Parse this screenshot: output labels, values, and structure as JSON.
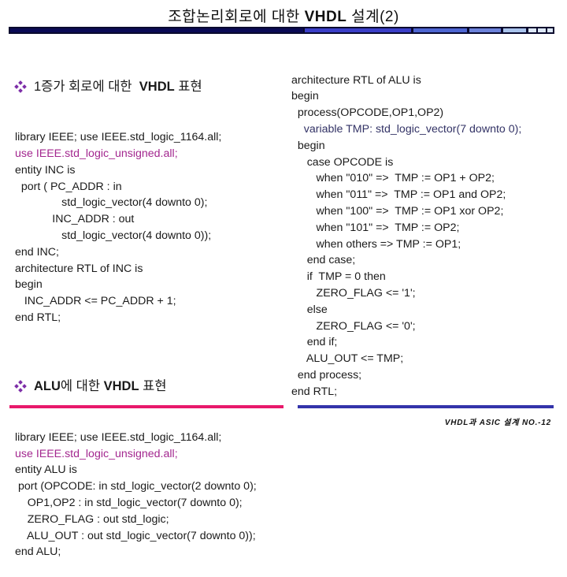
{
  "header": {
    "title_prefix": "조합논리회로에 대한 ",
    "title_bold": "VHDL",
    "title_suffix": " 설계(2)",
    "bar_colors": [
      "#0a0a55",
      "#3b3fc8",
      "#4e66d2",
      "#6c82da",
      "#a9c3ec",
      "#dde8f8",
      "#dde8f8",
      "#dde8f8"
    ]
  },
  "left": {
    "section1": {
      "icon": "diamond-bullet-icon",
      "heading_pre": "1증가 회로에 대한 ",
      "heading_bold": "VHDL",
      "heading_post": " 표현",
      "code": [
        {
          "text": "library IEEE; use IEEE.std_logic_1164.all;",
          "style": "normal"
        },
        {
          "text": "use IEEE.std_logic_unsigned.all;",
          "style": "magenta"
        },
        {
          "text": "entity INC is",
          "style": "normal"
        },
        {
          "text": "  port ( PC_ADDR : in",
          "style": "normal"
        },
        {
          "text": "               std_logic_vector(4 downto 0);",
          "style": "normal"
        },
        {
          "text": "            INC_ADDR : out",
          "style": "normal"
        },
        {
          "text": "               std_logic_vector(4 downto 0));",
          "style": "normal"
        },
        {
          "text": "end INC;",
          "style": "normal"
        },
        {
          "text": "architecture RTL of INC is",
          "style": "normal"
        },
        {
          "text": "begin",
          "style": "normal"
        },
        {
          "text": "   INC_ADDR <= PC_ADDR + 1;",
          "style": "normal"
        },
        {
          "text": "end RTL;",
          "style": "normal"
        }
      ]
    },
    "section2": {
      "icon": "diamond-bullet-icon",
      "heading_pre": "",
      "heading_bold": "ALU",
      "heading_mid": "에 대한 ",
      "heading_bold2": "VHDL",
      "heading_post": " 표현",
      "code": [
        {
          "text": "library IEEE; use IEEE.std_logic_1164.all;",
          "style": "normal"
        },
        {
          "text": "use IEEE.std_logic_unsigned.all;",
          "style": "magenta"
        },
        {
          "text": "entity ALU is",
          "style": "normal"
        },
        {
          "text": " port (OPCODE: in std_logic_vector(2 downto 0);",
          "style": "normal"
        },
        {
          "text": "    OP1,OP2 : in std_logic_vector(7 downto 0);",
          "style": "normal"
        },
        {
          "text": "    ZERO_FLAG : out std_logic;",
          "style": "normal"
        },
        {
          "text": "    ALU_OUT : out std_logic_vector(7 downto 0));",
          "style": "normal"
        },
        {
          "text": "end ALU;",
          "style": "normal"
        }
      ]
    }
  },
  "right": {
    "code": [
      {
        "text": "architecture RTL of ALU is",
        "style": "normal"
      },
      {
        "text": "begin",
        "style": "normal"
      },
      {
        "text": "  process(OPCODE,OP1,OP2)",
        "style": "normal"
      },
      {
        "text": "    variable TMP: std_logic_vector(7 downto 0);",
        "style": "slate"
      },
      {
        "text": "  begin",
        "style": "normal"
      },
      {
        "text": "     case OPCODE is",
        "style": "normal"
      },
      {
        "text": "        when \"010\" =>  TMP := OP1 + OP2;",
        "style": "normal"
      },
      {
        "text": "        when \"011\" =>  TMP := OP1 and OP2;",
        "style": "normal"
      },
      {
        "text": "        when \"100\" =>  TMP := OP1 xor OP2;",
        "style": "normal"
      },
      {
        "text": "        when \"101\" =>  TMP := OP2;",
        "style": "normal"
      },
      {
        "text": "        when others => TMP := OP1;",
        "style": "normal"
      },
      {
        "text": "     end case;",
        "style": "normal"
      },
      {
        "text": "     if  TMP = 0 then",
        "style": "normal"
      },
      {
        "text": "        ZERO_FLAG <= '1';",
        "style": "normal"
      },
      {
        "text": "     else",
        "style": "normal"
      },
      {
        "text": "        ZERO_FLAG <= '0';",
        "style": "normal"
      },
      {
        "text": "     end if;",
        "style": "normal"
      },
      {
        "text": "     ALU_OUT <= TMP;",
        "style": "normal"
      },
      {
        "text": "  end process;",
        "style": "normal"
      },
      {
        "text": "end RTL;",
        "style": "normal"
      }
    ]
  },
  "footer": {
    "text": "VHDL과 ASIC 설계  NO.-12",
    "left_rule_color": "#e8196b",
    "right_rule_color": "#3333aa"
  }
}
